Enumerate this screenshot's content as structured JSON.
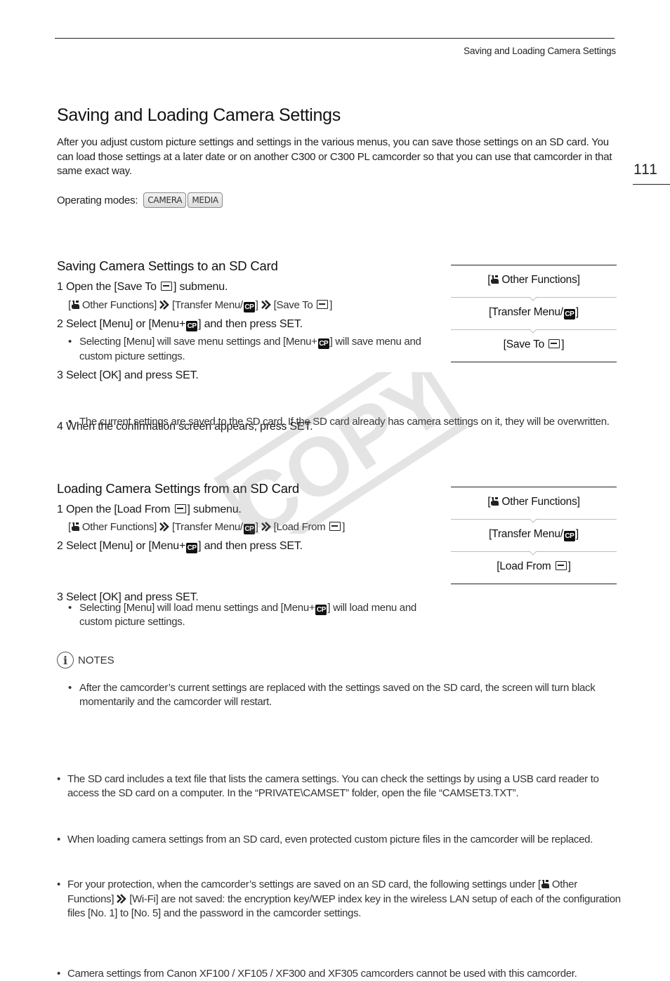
{
  "header": {
    "running_title": "Saving and Loading Camera Settings",
    "page_number": "111"
  },
  "title": "Saving and Loading Camera Settings",
  "intro": "After you adjust custom picture settings and settings in the various menus, you can save those settings on an SD card. You can load those settings at a later date or on another C300 or C300 PL camcorder so that you can use that camcorder in that same exact way.",
  "operating_modes": {
    "label": "Operating modes:",
    "modes": [
      "CAMERA",
      "MEDIA"
    ]
  },
  "icons": {
    "wrench": "wrench-icon",
    "arrow": "double-chevron-right-icon",
    "cp": "CP",
    "sd": "sd-card-icon",
    "info": "i"
  },
  "save_section": {
    "heading": "Saving Camera Settings to an SD Card",
    "step1": {
      "num": "1",
      "pre": "Open the [Save To ",
      "post": "] submenu."
    },
    "path": {
      "a": "Other Functions]",
      "b": "[Transfer Menu/",
      "b_end": "]",
      "c": "[Save To ",
      "c_end": "]"
    },
    "step2": {
      "num": "2",
      "pre": "Select [Menu] or [Menu+",
      "post": "] and then press SET."
    },
    "step2_bullet": {
      "pre": "Selecting [Menu] will save menu settings and [Menu+",
      "post": "] will save menu and custom picture settings."
    },
    "step3": {
      "num": "3",
      "text": "Select [OK] and press SET."
    },
    "step3_bullet": "The current settings are saved to the SD card. If the SD card already has camera settings on it, they will be overwritten.",
    "step4": {
      "num": "4",
      "text": "When the confirmation screen appears, press SET."
    },
    "flow": [
      "Other Functions]",
      "[Transfer Menu/",
      "[Save To "
    ]
  },
  "load_section": {
    "heading": "Loading Camera Settings from an SD Card",
    "step1": {
      "num": "1",
      "pre": "Open the [Load From ",
      "post": "] submenu."
    },
    "path": {
      "a": "Other Functions]",
      "b": "[Transfer Menu/",
      "b_end": "]",
      "c": "[Load From ",
      "c_end": "]"
    },
    "step2": {
      "num": "2",
      "pre": "Select [Menu] or [Menu+",
      "post": "] and then press SET."
    },
    "step2_bullet": {
      "pre": "Selecting [Menu] will load menu settings and [Menu+",
      "post": "] will load menu and custom picture settings."
    },
    "step3": {
      "num": "3",
      "text": "Select [OK] and press SET."
    },
    "step3_bullet": "After the camcorder’s current settings are replaced with the settings saved on the SD card, the screen will turn black momentarily and the camcorder will restart.",
    "flow": [
      "Other Functions]",
      "[Transfer Menu/",
      "[Load From "
    ]
  },
  "notes": {
    "heading": "NOTES",
    "items": [
      "The SD card includes a text file that lists the camera settings. You can check the settings by using a USB card reader to access the SD card on a computer. In the “PRIVATE\\CAMSET” folder, open the file “CAMSET3.TXT”.",
      "When loading camera settings from an SD card, even protected custom picture files in the camcorder will be replaced.",
      {
        "pre": "For your protection, when the camcorder’s settings are saved on an SD card, the following settings under",
        "path_a": "Other Functions]",
        "post": "[Wi-Fi] are not saved: the encryption key/WEP index key in the wireless LAN setup of each of the configuration files [No. 1] to [No. 5] and the password in the camcorder settings."
      },
      "Camera settings from Canon XF100 / XF105 / XF300 and XF305 camcorders cannot be used with this camcorder."
    ]
  },
  "watermark": "COPY"
}
